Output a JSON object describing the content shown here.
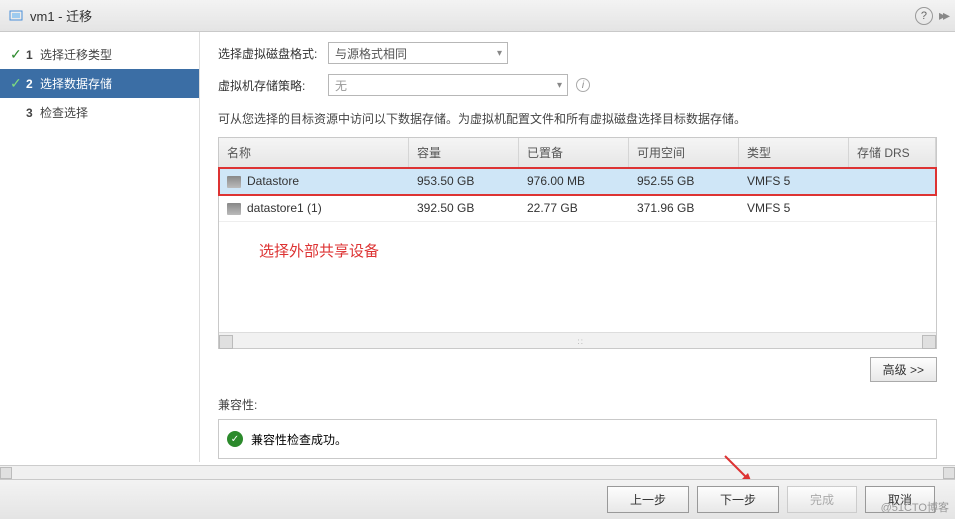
{
  "header": {
    "title": "vm1 - 迁移"
  },
  "steps": [
    {
      "num": "1",
      "label": "选择迁移类型",
      "done": true
    },
    {
      "num": "2",
      "label": "选择数据存储",
      "done": true,
      "selected": true
    },
    {
      "num": "3",
      "label": "检查选择"
    }
  ],
  "form": {
    "diskFormatLabel": "选择虚拟磁盘格式:",
    "diskFormatValue": "与源格式相同",
    "storagePolicyLabel": "虚拟机存储策略:",
    "storagePolicyValue": "无",
    "description": "可从您选择的目标资源中访问以下数据存储。为虚拟机配置文件和所有虚拟磁盘选择目标数据存储。"
  },
  "table": {
    "headers": {
      "name": "名称",
      "capacity": "容量",
      "provisioned": "已置备",
      "free": "可用空间",
      "type": "类型",
      "drs": "存储 DRS"
    },
    "rows": [
      {
        "name": "Datastore",
        "capacity": "953.50 GB",
        "provisioned": "976.00 MB",
        "free": "952.55 GB",
        "type": "VMFS 5",
        "selected": true
      },
      {
        "name": "datastore1 (1)",
        "capacity": "392.50 GB",
        "provisioned": "22.77 GB",
        "free": "371.96 GB",
        "type": "VMFS 5"
      }
    ]
  },
  "annotation": "选择外部共享设备",
  "advancedBtn": "高级 >>",
  "compat": {
    "label": "兼容性:",
    "msg": "兼容性检查成功。"
  },
  "footer": {
    "back": "上一步",
    "next": "下一步",
    "finish": "完成",
    "cancel": "取消"
  },
  "watermark": "@51CTO博客"
}
